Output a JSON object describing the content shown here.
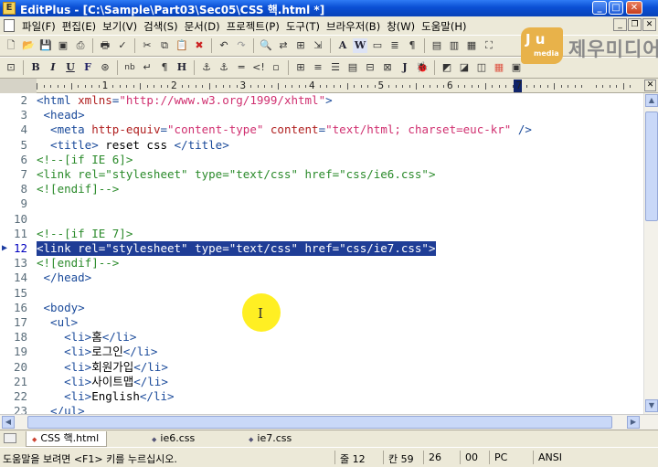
{
  "window": {
    "title": "EditPlus - [C:\\Sample\\Part03\\Sec05\\CSS 핵.html *]"
  },
  "menu": {
    "items": [
      "파일(F)",
      "편집(E)",
      "보기(V)",
      "검색(S)",
      "문서(D)",
      "프로젝트(P)",
      "도구(T)",
      "브라우저(B)",
      "창(W)",
      "도움말(H)"
    ]
  },
  "logo": {
    "badge": "J u",
    "badge_sub": "media",
    "name": "제우미디어"
  },
  "ruler": {
    "numbers": [
      "1",
      "2",
      "3",
      "4",
      "5",
      "6",
      "7"
    ]
  },
  "editor": {
    "current_line": 12,
    "lines": [
      {
        "n": "2",
        "segments": [
          {
            "t": "<html ",
            "c": "tag"
          },
          {
            "t": "xmlns",
            "c": "attr"
          },
          {
            "t": "=",
            "c": "tag"
          },
          {
            "t": "\"http://www.w3.org/1999/xhtml\"",
            "c": "val"
          },
          {
            "t": ">",
            "c": "tag"
          }
        ]
      },
      {
        "n": "3",
        "segments": [
          {
            "t": " <head>",
            "c": "tag"
          }
        ]
      },
      {
        "n": "4",
        "segments": [
          {
            "t": "  <meta ",
            "c": "tag"
          },
          {
            "t": "http-equiv",
            "c": "attr"
          },
          {
            "t": "=",
            "c": "tag"
          },
          {
            "t": "\"content-type\"",
            "c": "val"
          },
          {
            "t": " content",
            "c": "attr"
          },
          {
            "t": "=",
            "c": "tag"
          },
          {
            "t": "\"text/html; charset=euc-kr\"",
            "c": "val"
          },
          {
            "t": " />",
            "c": "tag"
          }
        ]
      },
      {
        "n": "5",
        "segments": [
          {
            "t": "  <title>",
            "c": "tag"
          },
          {
            "t": " reset css ",
            "c": "txt"
          },
          {
            "t": "</title>",
            "c": "tag"
          }
        ]
      },
      {
        "n": "6",
        "segments": [
          {
            "t": "<!--[if IE 6]>",
            "c": "cmt"
          }
        ]
      },
      {
        "n": "7",
        "segments": [
          {
            "t": "<link rel=\"stylesheet\" type=\"text/css\" href=\"css/ie6.css\">",
            "c": "cmt"
          }
        ]
      },
      {
        "n": "8",
        "segments": [
          {
            "t": "<![endif]-->",
            "c": "cmt"
          }
        ]
      },
      {
        "n": "9",
        "segments": []
      },
      {
        "n": "10",
        "segments": []
      },
      {
        "n": "11",
        "segments": [
          {
            "t": "<!--[if IE 7]>",
            "c": "cmt"
          }
        ]
      },
      {
        "n": "12",
        "segments": [
          {
            "t": "<link rel=\"stylesheet\" type=\"text/css\" href=\"css/ie7.css\">",
            "c": "cmt"
          }
        ]
      },
      {
        "n": "13",
        "segments": [
          {
            "t": "<![endif]-->",
            "c": "cmt"
          }
        ]
      },
      {
        "n": "14",
        "segments": [
          {
            "t": " </head>",
            "c": "tag"
          }
        ]
      },
      {
        "n": "15",
        "segments": []
      },
      {
        "n": "16",
        "segments": [
          {
            "t": " <body>",
            "c": "tag"
          }
        ]
      },
      {
        "n": "17",
        "segments": [
          {
            "t": "  <ul>",
            "c": "tag"
          }
        ]
      },
      {
        "n": "18",
        "segments": [
          {
            "t": "    <li>",
            "c": "tag"
          },
          {
            "t": "홈",
            "c": "txt"
          },
          {
            "t": "</li>",
            "c": "tag"
          }
        ]
      },
      {
        "n": "19",
        "segments": [
          {
            "t": "    <li>",
            "c": "tag"
          },
          {
            "t": "로그인",
            "c": "txt"
          },
          {
            "t": "</li>",
            "c": "tag"
          }
        ]
      },
      {
        "n": "20",
        "segments": [
          {
            "t": "    <li>",
            "c": "tag"
          },
          {
            "t": "회원가입",
            "c": "txt"
          },
          {
            "t": "</li>",
            "c": "tag"
          }
        ]
      },
      {
        "n": "21",
        "segments": [
          {
            "t": "    <li>",
            "c": "tag"
          },
          {
            "t": "사이트맵",
            "c": "txt"
          },
          {
            "t": "</li>",
            "c": "tag"
          }
        ]
      },
      {
        "n": "22",
        "segments": [
          {
            "t": "    <li>",
            "c": "tag"
          },
          {
            "t": "English",
            "c": "txt"
          },
          {
            "t": "</li>",
            "c": "tag"
          }
        ]
      },
      {
        "n": "23",
        "segments": [
          {
            "t": "  </ul>",
            "c": "tag"
          }
        ]
      }
    ]
  },
  "tabs": [
    {
      "label": "CSS 핵.html",
      "active": true
    },
    {
      "label": "ie6.css",
      "active": false
    },
    {
      "label": "ie7.css",
      "active": false
    }
  ],
  "status": {
    "help": "도움말을 보려면 <F1> 키를 누르십시오.",
    "line": "줄 12",
    "col": "칸 59",
    "num1": "26",
    "num2": "00",
    "mode": "PC",
    "encoding": "ANSI"
  },
  "colors": {
    "tag": "#1a4a9a",
    "attr": "#b02020",
    "value": "#d03070",
    "comment": "#2a8a2a",
    "selection": "#1f3d96",
    "cursor_highlight": "#ffee10"
  }
}
